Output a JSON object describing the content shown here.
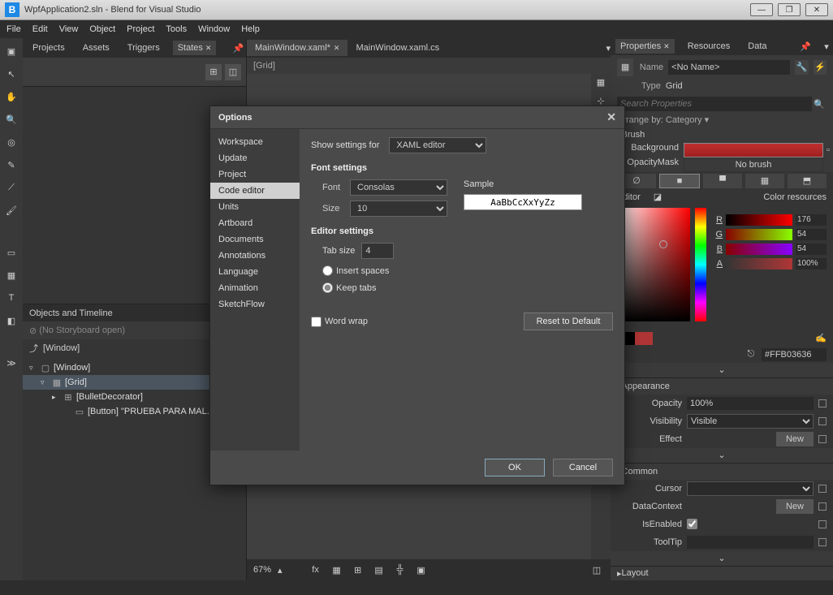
{
  "titlebar": {
    "icon_letter": "B",
    "title": "WpfApplication2.sln - Blend for Visual Studio"
  },
  "menubar": [
    "File",
    "Edit",
    "View",
    "Object",
    "Project",
    "Tools",
    "Window",
    "Help"
  ],
  "left_tabs": {
    "items": [
      "Projects",
      "Assets",
      "Triggers",
      "States"
    ],
    "active_index": 3
  },
  "timeline": {
    "header": "Objects and Timeline",
    "storyboard": "(No Storyboard open)",
    "root": "[Window]",
    "tree": [
      {
        "depth": 0,
        "expand": "▿",
        "icon": "▢",
        "text": "[Window]"
      },
      {
        "depth": 1,
        "expand": "▿",
        "icon": "▦",
        "text": "[Grid]",
        "selected": true
      },
      {
        "depth": 2,
        "expand": "▸",
        "icon": "⊞",
        "text": "[BulletDecorator]"
      },
      {
        "depth": 3,
        "expand": "",
        "icon": "▭",
        "text": "[Button] \"PRUEBA PARA MAL..."
      }
    ]
  },
  "center": {
    "tabs": [
      {
        "label": "MainWindow.xaml*",
        "active": true,
        "close": true
      },
      {
        "label": "MainWindow.xaml.cs",
        "active": false,
        "close": false
      }
    ],
    "breadcrumb": "[Grid]",
    "zoom": "67%"
  },
  "right_tabs": {
    "items": [
      "Properties",
      "Resources",
      "Data"
    ],
    "active_index": 0
  },
  "properties": {
    "name_label": "Name",
    "name_value": "<No Name>",
    "type_label": "Type",
    "type_value": "Grid",
    "search_placeholder": "Search Properties",
    "arrange": "Arrange by: Category ▾",
    "brush_section": "Brush",
    "background_label": "Background",
    "opacitymask_label": "OpacityMask",
    "opacitymask_text": "No brush",
    "editor_label": "Editor",
    "color_res_label": "Color resources",
    "r": "176",
    "g": "54",
    "b": "54",
    "a": "100%",
    "hex": "#FFB03636",
    "appearance_section": "Appearance",
    "opacity_label": "Opacity",
    "opacity_value": "100%",
    "visibility_label": "Visibility",
    "visibility_value": "Visible",
    "effect_label": "Effect",
    "new_btn": "New",
    "common_section": "Common",
    "cursor_label": "Cursor",
    "datacontext_label": "DataContext",
    "isenabled_label": "IsEnabled",
    "tooltip_label": "ToolTip",
    "layout_section": "Layout"
  },
  "dialog": {
    "title": "Options",
    "sidebar": [
      "Workspace",
      "Update",
      "Project",
      "Code editor",
      "Units",
      "Artboard",
      "Documents",
      "Annotations",
      "Language",
      "Animation",
      "SketchFlow"
    ],
    "sidebar_selected": 3,
    "show_settings_for_label": "Show settings for",
    "show_settings_for_value": "XAML editor",
    "font_settings": "Font settings",
    "font_label": "Font",
    "font_value": "Consolas",
    "size_label": "Size",
    "size_value": "10",
    "sample_label": "Sample",
    "sample_text": "AaBbCcXxYyZz",
    "editor_settings": "Editor settings",
    "tabsize_label": "Tab size",
    "tabsize_value": "4",
    "insert_spaces": "Insert spaces",
    "keep_tabs": "Keep tabs",
    "word_wrap": "Word wrap",
    "reset": "Reset to Default",
    "ok": "OK",
    "cancel": "Cancel"
  }
}
